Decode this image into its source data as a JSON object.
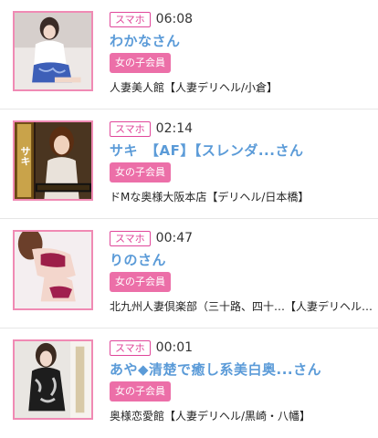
{
  "entries": [
    {
      "badge": "スマホ",
      "time": "06:08",
      "name": "わかなさん",
      "member_label": "女の子会員",
      "shop": "人妻美人館【人妻デリヘル/小倉】"
    },
    {
      "badge": "スマホ",
      "time": "02:14",
      "name": "サキ　【AF】【スレンダ...さん",
      "member_label": "女の子会員",
      "shop": "ドMな奥様大阪本店【デリヘル/日本橋】",
      "thumb_caption": "サキ"
    },
    {
      "badge": "スマホ",
      "time": "00:47",
      "name": "りのさん",
      "member_label": "女の子会員",
      "shop": "北九州人妻倶楽部（三十路、四十…【人妻デリヘル…"
    },
    {
      "badge": "スマホ",
      "time": "00:01",
      "name": "あや◆清楚で癒し系美白奥...さん",
      "member_label": "女の子会員",
      "shop": "奥様恋愛館【人妻デリヘル/黒崎・八幡】"
    }
  ],
  "colors": {
    "accent_pink": "#ec6fa8",
    "badge_pink": "#e0479a",
    "name_blue": "#5b9bd8",
    "thumb_border": "#f08ab4"
  }
}
